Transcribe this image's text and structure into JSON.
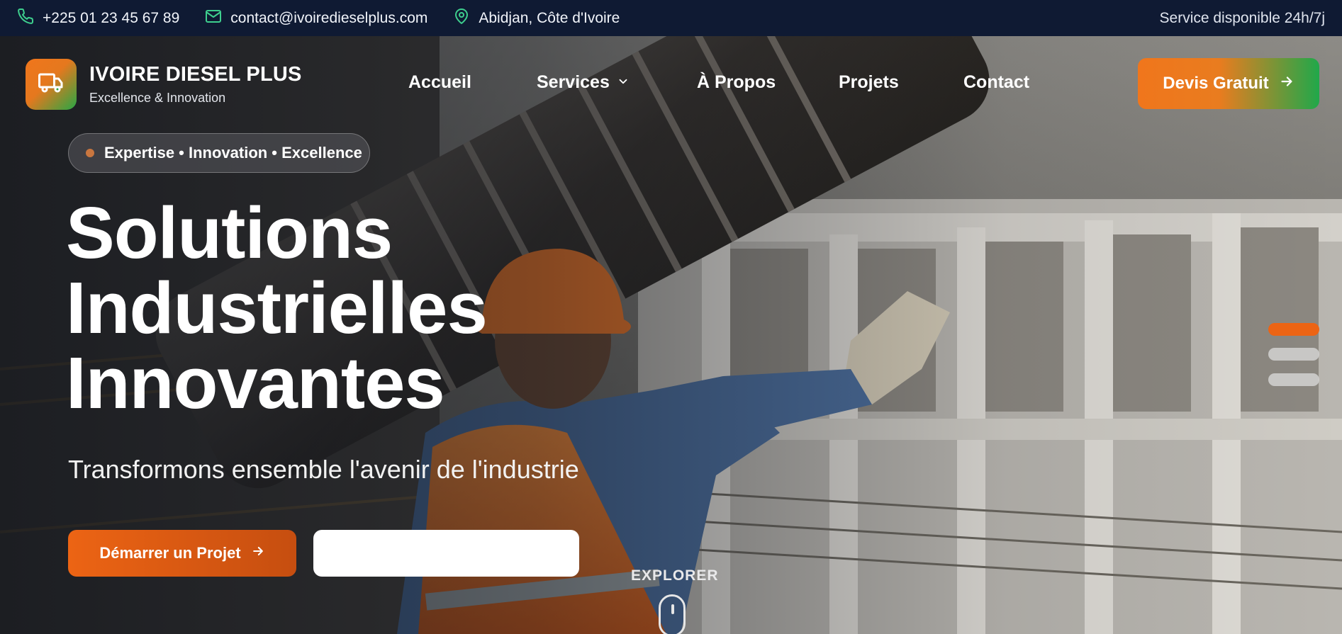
{
  "topbar": {
    "phone": "+225 01 23 45 67 89",
    "email": "contact@ivoiredieselplus.com",
    "location": "Abidjan, Côte d'Ivoire",
    "service": "Service disponible 24h/7j"
  },
  "brand": {
    "name": "IVOIRE DIESEL PLUS",
    "tagline": "Excellence & Innovation"
  },
  "nav": {
    "items": [
      {
        "label": "Accueil"
      },
      {
        "label": "Services"
      },
      {
        "label": "À Propos"
      },
      {
        "label": "Projets"
      },
      {
        "label": "Contact"
      }
    ],
    "cta_label": "Devis Gratuit"
  },
  "hero": {
    "badge": "Expertise • Innovation • Excellence",
    "title_lines": [
      "Solutions",
      "Industrielles",
      "Innovantes"
    ],
    "subtitle": "Transformons ensemble l'avenir de l'industrie",
    "primary_button": "Démarrer un Projet",
    "secondary_button": "",
    "explore_label": "EXPLORER"
  },
  "slider": {
    "count": 3,
    "active_index": 0
  },
  "colors": {
    "topbar_bg": "#0f1a33",
    "accent_orange": "#f0761c",
    "accent_green": "#28a745",
    "icon_green": "#3ecf8e",
    "indicator_active": "#ec6414",
    "indicator_inactive": "#d9d9d9"
  },
  "icons": {
    "phone": "phone-icon",
    "email": "mail-icon",
    "location": "map-pin-icon",
    "logo": "truck-icon",
    "dropdown": "chevron-down-icon",
    "arrow": "arrow-right-icon",
    "scroll": "mouse-icon"
  }
}
